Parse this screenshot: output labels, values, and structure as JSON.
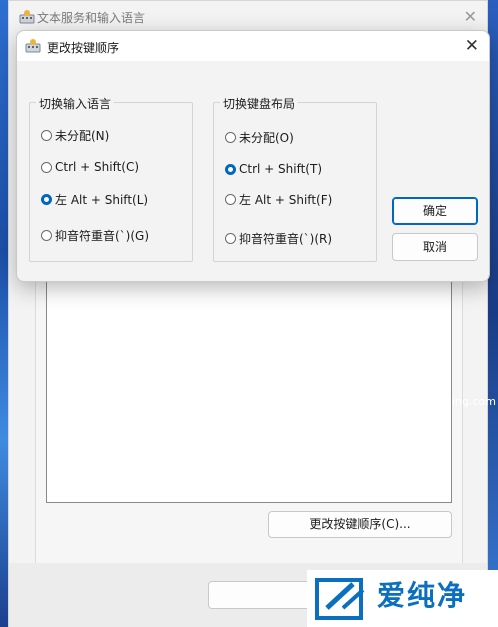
{
  "background_window": {
    "title": "文本服务和输入语言",
    "change_button": "更改按键顺序(C)..."
  },
  "dialog": {
    "title": "更改按键顺序",
    "group_input_language": {
      "label": "切换输入语言",
      "options": [
        "未分配(N)",
        "Ctrl + Shift(C)",
        "左 Alt + Shift(L)",
        "抑音符重音(`)(G)"
      ],
      "selected": 2
    },
    "group_keyboard_layout": {
      "label": "切换键盘布局",
      "options": [
        "未分配(O)",
        "Ctrl + Shift(T)",
        "左 Alt + Shift(F)",
        "抑音符重音(`)(R)"
      ],
      "selected": 1
    },
    "ok_label": "确定",
    "cancel_label": "取消"
  },
  "watermark": {
    "brand": "爱纯净",
    "url": "aichunjing.com"
  },
  "colors": {
    "accent": "#0067c0",
    "watermark": "#0a6fbf"
  }
}
